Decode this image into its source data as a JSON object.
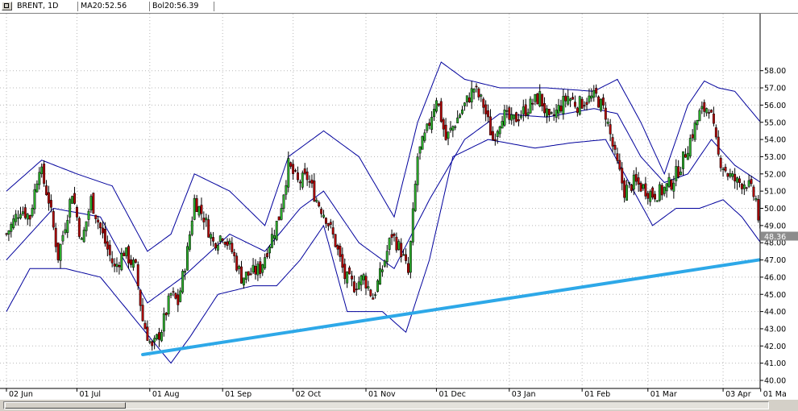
{
  "header": {
    "symbol": "BRENT, 1D",
    "ma": "MA20:52.56",
    "bol": "Bol20:56.39"
  },
  "colors": {
    "up": "#2cb02c",
    "down": "#b40000",
    "wick": "#000000",
    "indicator": "#00009c",
    "trendline": "#2da8e8",
    "grid": "#b8b8b8",
    "last_label_bg": "#8c8c8c"
  },
  "chart_data": {
    "type": "candlestick",
    "title": "",
    "ylim": [
      40,
      58.5
    ],
    "y_ticks": [
      "40.00",
      "41.00",
      "42.00",
      "43.00",
      "44.00",
      "45.00",
      "46.00",
      "47.00",
      "48.00",
      "49.00",
      "50.00",
      "51.00",
      "52.00",
      "53.00",
      "54.00",
      "55.00",
      "56.00",
      "57.00",
      "58.00"
    ],
    "x_labels": [
      "02 Jun",
      "01 Jul",
      "01 Aug",
      "01 Sep",
      "02 Oct",
      "01 Nov",
      "01 Dec",
      "03 Jan",
      "01 Feb",
      "01 Mar",
      "03 Apr",
      "01 Ma"
    ],
    "last_price": "48.36",
    "close_path": [
      [
        0,
        48.5
      ],
      [
        6,
        50.0
      ],
      [
        10,
        49.5
      ],
      [
        14,
        52.5
      ],
      [
        18,
        50.5
      ],
      [
        22,
        47.2
      ],
      [
        28,
        51.0
      ],
      [
        32,
        48.0
      ],
      [
        36,
        50.5
      ],
      [
        42,
        48.0
      ],
      [
        46,
        46.5
      ],
      [
        50,
        47.5
      ],
      [
        55,
        46.5
      ],
      [
        58,
        43.5
      ],
      [
        62,
        41.8
      ],
      [
        66,
        43.0
      ],
      [
        70,
        45.0
      ],
      [
        73,
        44.5
      ],
      [
        77,
        47.5
      ],
      [
        80,
        50.5
      ],
      [
        84,
        49.5
      ],
      [
        88,
        48.0
      ],
      [
        92,
        48.5
      ],
      [
        96,
        47.5
      ],
      [
        100,
        46.0
      ],
      [
        104,
        46.2
      ],
      [
        108,
        46.5
      ],
      [
        112,
        48.0
      ],
      [
        116,
        49.5
      ],
      [
        120,
        52.5
      ],
      [
        124,
        51.5
      ],
      [
        128,
        51.8
      ],
      [
        132,
        50.5
      ],
      [
        136,
        49.5
      ],
      [
        140,
        48.0
      ],
      [
        144,
        46.0
      ],
      [
        148,
        45.5
      ],
      [
        152,
        46.0
      ],
      [
        156,
        44.8
      ],
      [
        160,
        46.5
      ],
      [
        164,
        48.5
      ],
      [
        168,
        47.5
      ],
      [
        171,
        46.2
      ],
      [
        175,
        53.0
      ],
      [
        179,
        54.5
      ],
      [
        183,
        56.5
      ],
      [
        187,
        54.0
      ],
      [
        191,
        55.0
      ],
      [
        195,
        56.0
      ],
      [
        199,
        57.0
      ],
      [
        203,
        56.0
      ],
      [
        207,
        54.0
      ],
      [
        211,
        55.5
      ],
      [
        215,
        55.0
      ],
      [
        219,
        55.5
      ],
      [
        223,
        56.0
      ],
      [
        227,
        56.5
      ],
      [
        231,
        55.0
      ],
      [
        235,
        55.8
      ],
      [
        239,
        56.5
      ],
      [
        243,
        56.0
      ],
      [
        247,
        56.3
      ],
      [
        251,
        56.5
      ],
      [
        255,
        55.5
      ],
      [
        259,
        53.0
      ],
      [
        263,
        51.0
      ],
      [
        267,
        51.5
      ],
      [
        271,
        51.2
      ],
      [
        275,
        50.8
      ],
      [
        279,
        51.0
      ],
      [
        283,
        51.5
      ],
      [
        287,
        52.5
      ],
      [
        291,
        54.0
      ],
      [
        295,
        55.5
      ],
      [
        299,
        56.0
      ],
      [
        303,
        53.0
      ],
      [
        307,
        52.0
      ],
      [
        311,
        51.5
      ],
      [
        315,
        51.5
      ],
      [
        319,
        50.5
      ],
      [
        321,
        48.4
      ]
    ],
    "bands": {
      "middle": [
        [
          0,
          47.0
        ],
        [
          20,
          50.0
        ],
        [
          40,
          49.5
        ],
        [
          60,
          44.5
        ],
        [
          75,
          46.0
        ],
        [
          95,
          48.5
        ],
        [
          110,
          47.5
        ],
        [
          125,
          50.0
        ],
        [
          135,
          51.0
        ],
        [
          150,
          48.0
        ],
        [
          165,
          46.5
        ],
        [
          180,
          50.5
        ],
        [
          195,
          54.0
        ],
        [
          210,
          55.5
        ],
        [
          230,
          55.3
        ],
        [
          250,
          55.8
        ],
        [
          260,
          55.5
        ],
        [
          270,
          53.0
        ],
        [
          280,
          51.5
        ],
        [
          290,
          52.0
        ],
        [
          300,
          54.0
        ],
        [
          310,
          52.5
        ],
        [
          321,
          51.5
        ]
      ],
      "upper": [
        [
          0,
          51.0
        ],
        [
          15,
          52.8
        ],
        [
          30,
          52.0
        ],
        [
          45,
          51.3
        ],
        [
          60,
          47.5
        ],
        [
          70,
          48.5
        ],
        [
          80,
          52.0
        ],
        [
          95,
          51.0
        ],
        [
          110,
          49.0
        ],
        [
          120,
          53.0
        ],
        [
          135,
          54.5
        ],
        [
          150,
          53.0
        ],
        [
          165,
          49.5
        ],
        [
          175,
          55.0
        ],
        [
          185,
          58.5
        ],
        [
          195,
          57.5
        ],
        [
          210,
          57.0
        ],
        [
          230,
          57.0
        ],
        [
          250,
          56.8
        ],
        [
          260,
          57.5
        ],
        [
          270,
          55.0
        ],
        [
          280,
          52.0
        ],
        [
          290,
          56.0
        ],
        [
          297,
          57.4
        ],
        [
          303,
          57.0
        ],
        [
          310,
          56.8
        ],
        [
          321,
          55.0
        ]
      ],
      "lower": [
        [
          0,
          44.0
        ],
        [
          10,
          46.5
        ],
        [
          25,
          46.5
        ],
        [
          40,
          46.0
        ],
        [
          55,
          43.5
        ],
        [
          70,
          41.0
        ],
        [
          78,
          42.5
        ],
        [
          90,
          45.0
        ],
        [
          105,
          45.5
        ],
        [
          115,
          45.5
        ],
        [
          125,
          47.0
        ],
        [
          135,
          49.0
        ],
        [
          145,
          44.0
        ],
        [
          160,
          44.0
        ],
        [
          170,
          42.8
        ],
        [
          180,
          47.0
        ],
        [
          190,
          53.0
        ],
        [
          205,
          54.0
        ],
        [
          225,
          53.5
        ],
        [
          240,
          53.8
        ],
        [
          255,
          54.0
        ],
        [
          265,
          51.5
        ],
        [
          275,
          49.0
        ],
        [
          285,
          50.0
        ],
        [
          295,
          50.0
        ],
        [
          305,
          50.5
        ],
        [
          313,
          49.5
        ],
        [
          321,
          48.0
        ]
      ]
    },
    "trendline": {
      "start": [
        58,
        41.5
      ],
      "end": [
        321,
        47.1
      ]
    }
  }
}
